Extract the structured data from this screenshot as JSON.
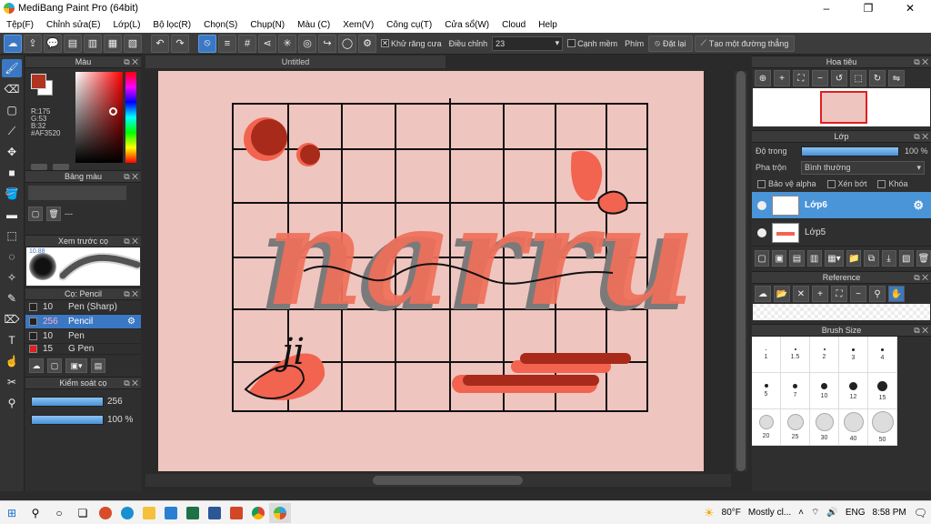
{
  "window": {
    "title": "MediBang Paint Pro (64bit)",
    "minimize": "–",
    "restore": "❐",
    "close": "✕"
  },
  "menu": [
    "Tệp(F)",
    "Chỉnh sửa(E)",
    "Lớp(L)",
    "Bộ lọc(R)",
    "Chọn(S)",
    "Chụp(N)",
    "Màu (C)",
    "Xem(V)",
    "Công cụ(T)",
    "Cửa sổ(W)",
    "Cloud",
    "Help"
  ],
  "toolbar": {
    "antialias_label": "Khử răng cưa",
    "adjust_label": "Điều chỉnh",
    "adjust_value": "23",
    "smooth_label": "Cạnh mềm",
    "key_label": "Phím",
    "reset_label": "Đặt lại",
    "line_label": "Tạo một đường thẳng"
  },
  "panels": {
    "color": {
      "title": "Màu",
      "r": "R:175",
      "g": "G:53",
      "b": "B:32",
      "hex": "#AF3520",
      "fg": "#AF3520"
    },
    "palette": {
      "title": "Bảng màu",
      "value": "---"
    },
    "brush_preview": {
      "title": "Xem trước cọ",
      "size": "10.88"
    },
    "brushes": {
      "title": "Cọ: Pencil",
      "items": [
        {
          "size": "10",
          "name": "Pen (Sharp)"
        },
        {
          "size": "256",
          "name": "Pencil"
        },
        {
          "size": "10",
          "name": "Pen"
        },
        {
          "size": "15",
          "name": "G Pen"
        }
      ]
    },
    "brush_control": {
      "title": "Kiểm soát cọ",
      "size": "256",
      "opacity": "100 %"
    },
    "navigator": {
      "title": "Hoa tiêu"
    },
    "layer": {
      "title": "Lớp",
      "opacity_label": "Độ trong",
      "opacity_value": "100 %",
      "blend_label": "Pha trộn",
      "blend_value": "Bình thường",
      "protect_label": "Bảo vệ alpha",
      "clip_label": "Xén bớt",
      "lock_label": "Khóa",
      "layers": [
        "Lớp6",
        "Lớp5"
      ]
    },
    "reference": {
      "title": "Reference"
    },
    "brush_size": {
      "title": "Brush Size",
      "sizes": [
        "1",
        "1.5",
        "2",
        "3",
        "4",
        "5",
        "7",
        "10",
        "12",
        "15",
        "20",
        "25",
        "30",
        "40",
        "50"
      ]
    }
  },
  "document": {
    "tab": "Untitled",
    "artwork_text": "narru",
    "artwork_sub": "ji"
  },
  "taskbar": {
    "weather_temp": "80°F",
    "weather_text": "Mostly cl...",
    "lang": "ENG",
    "time": "8:58 PM"
  },
  "colors": {
    "accent": "#3b78c4",
    "canvas_bg": "#efc5bf",
    "coral": "#f26450",
    "dark_red": "#a82a1a"
  }
}
